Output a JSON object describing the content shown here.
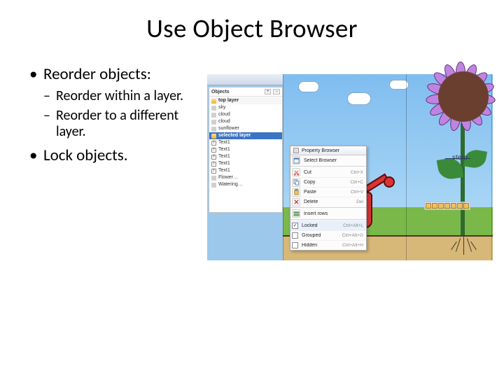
{
  "title": "Use Object Browser",
  "bullets": {
    "b1a": "Reorder objects:",
    "b2a": "Reorder within a layer.",
    "b2b": "Reorder to a different layer.",
    "b1b": "Lock objects."
  },
  "panel": {
    "tab": "Objects",
    "zoom_in": "+",
    "zoom_out": "−",
    "top_layer": "top layer",
    "items_top": [
      "sky",
      "cloud",
      "cloud",
      "sunflower"
    ],
    "selected_layer": "selected layer",
    "items_sel": [
      "Text1",
      "Text1",
      "Text1",
      "Text1",
      "Text1",
      "Flower…",
      "Watering…"
    ]
  },
  "ctx": {
    "header": "Property Browser",
    "pin": "📌",
    "rows": [
      {
        "label": "Select Browser",
        "shortcut": "",
        "icon": "browser"
      },
      {
        "label": "Cut",
        "shortcut": "Ctrl+X",
        "icon": "cut"
      },
      {
        "label": "Copy",
        "shortcut": "Ctrl+C",
        "icon": "copy"
      },
      {
        "label": "Paste",
        "shortcut": "Ctrl+V",
        "icon": "paste"
      },
      {
        "label": "Delete",
        "shortcut": "Del",
        "icon": "delete"
      },
      {
        "label": "Insert rows",
        "shortcut": "",
        "icon": "insert"
      },
      {
        "label": "Locked",
        "shortcut": "Ctrl+Alt+L",
        "icon": "check",
        "checked": true
      },
      {
        "label": "Grouped",
        "shortcut": "Ctrl+Alt+G",
        "icon": "check",
        "checked": false
      },
      {
        "label": "Hidden",
        "shortcut": "Ctrl+Alt+H",
        "icon": "check",
        "checked": false
      }
    ]
  },
  "scene": {
    "stem_label": "stem"
  }
}
